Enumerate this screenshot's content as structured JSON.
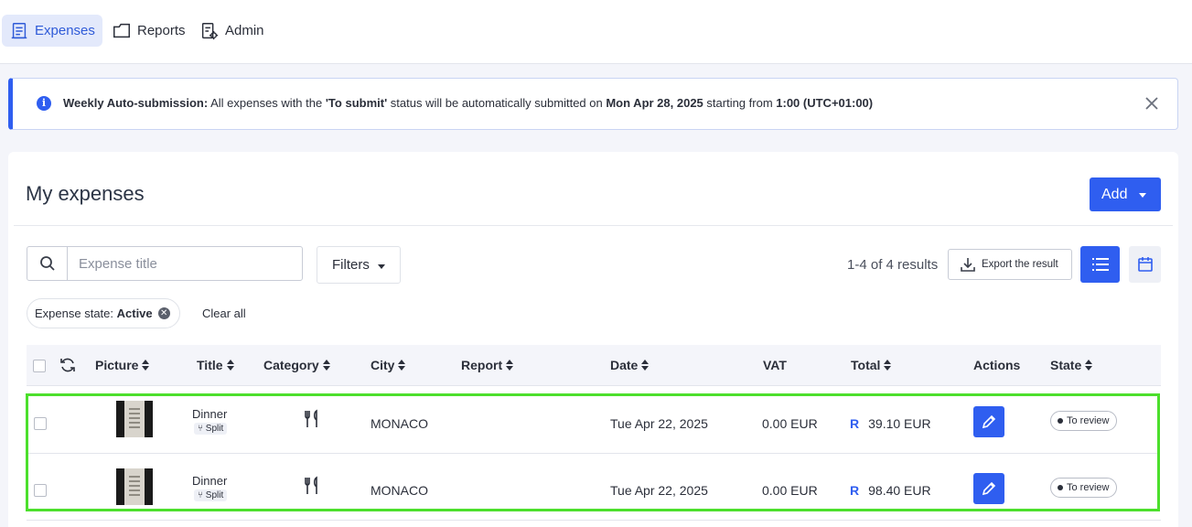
{
  "nav": {
    "tabs": [
      {
        "label": "Expenses",
        "icon": "receipt-icon",
        "active": true
      },
      {
        "label": "Reports",
        "icon": "folder-icon",
        "active": false
      },
      {
        "label": "Admin",
        "icon": "admin-settings-icon",
        "active": false
      }
    ]
  },
  "banner": {
    "lead": "Weekly Auto-submission:",
    "text1": " All expenses with the ",
    "status": "'To submit'",
    "text2": " status will be automatically submitted on ",
    "date": "Mon Apr 28, 2025",
    "text3": " starting from ",
    "time": "1:00 (UTC+01:00)"
  },
  "page": {
    "title": "My expenses",
    "add_label": "Add"
  },
  "toolbar": {
    "search_placeholder": "Expense title",
    "filters_label": "Filters",
    "results": "1-4 of 4 results",
    "export_label": "Export the result"
  },
  "chips": {
    "label": "Expense state: ",
    "value": "Active",
    "clear_all": "Clear all"
  },
  "table": {
    "headers": {
      "picture": "Picture",
      "title": "Title",
      "category": "Category",
      "city": "City",
      "report": "Report",
      "date": "Date",
      "vat": "VAT",
      "total": "Total",
      "actions": "Actions",
      "state": "State"
    },
    "rows": [
      {
        "title": "Dinner",
        "split": "Split",
        "category_icon": "fork-knife-icon",
        "city": "MONACO",
        "report": "",
        "date": "Tue Apr 22, 2025",
        "vat": "0.00 EUR",
        "total_badge": "R",
        "total": "39.10 EUR",
        "state": "To review"
      },
      {
        "title": "Dinner",
        "split": "Split",
        "category_icon": "fork-knife-icon",
        "city": "MONACO",
        "report": "",
        "date": "Tue Apr 22, 2025",
        "vat": "0.00 EUR",
        "total_badge": "R",
        "total": "98.40 EUR",
        "state": "To review"
      }
    ]
  },
  "colors": {
    "accent": "#2f5ef0",
    "highlight": "#4cdf2c",
    "active_tab_bg": "#e3e9fb"
  }
}
